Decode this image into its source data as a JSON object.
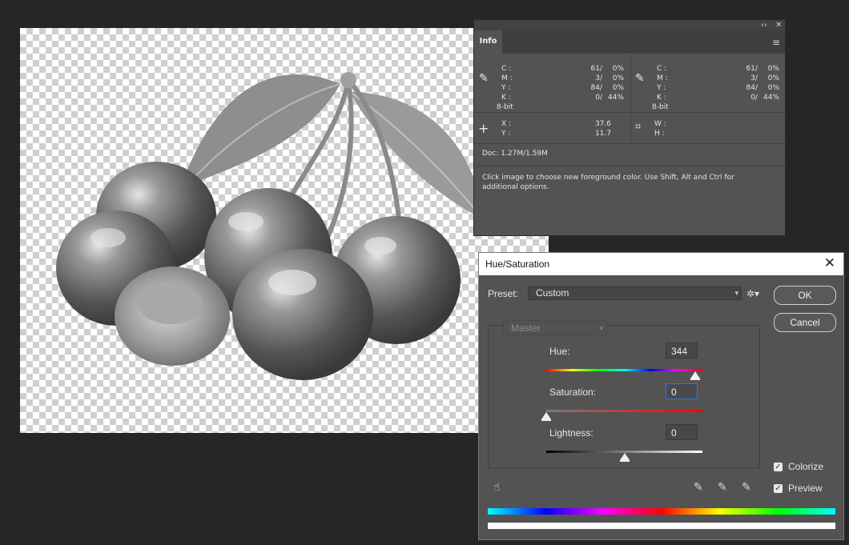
{
  "info_panel": {
    "collapse_glyph": "‹‹",
    "close_glyph": "✕",
    "tab_label": "Info",
    "menu_glyph": "≡",
    "left_color": {
      "labels": "C :\nM :\nY :\nK :",
      "values_a": "61/\n3/\n84/\n0/",
      "values_b": "0%\n0%\n0%\n44%",
      "bit_depth": "8-bit"
    },
    "right_color": {
      "labels": "C :\nM :\nY :\nK :",
      "values_a": "61/\n3/\n84/\n0/",
      "values_b": "0%\n0%\n0%\n44%",
      "bit_depth": "8-bit"
    },
    "position": {
      "labels": "X :\nY :",
      "values": "37.6\n11.7"
    },
    "size": {
      "labels": "W :\nH :"
    },
    "doc": "Doc: 1.27M/1.59M",
    "hint": "Click image to choose new foreground color.  Use Shift, Alt and Ctrl for additional options."
  },
  "dialog": {
    "title": "Hue/Saturation",
    "close_glyph": "✕",
    "preset_label": "Preset:",
    "preset_value": "Custom",
    "ok_label": "OK",
    "cancel_label": "Cancel",
    "channel": "Master",
    "hue_label": "Hue:",
    "hue_value": "344",
    "saturation_label": "Saturation:",
    "saturation_value": "0",
    "lightness_label": "Lightness:",
    "lightness_value": "0",
    "colorize_label": "Colorize",
    "colorize_checked": true,
    "preview_label": "Preview",
    "preview_checked": true,
    "hue_slider_fraction": 0.955,
    "saturation_slider_fraction": 0.0,
    "lightness_slider_fraction": 0.5
  }
}
